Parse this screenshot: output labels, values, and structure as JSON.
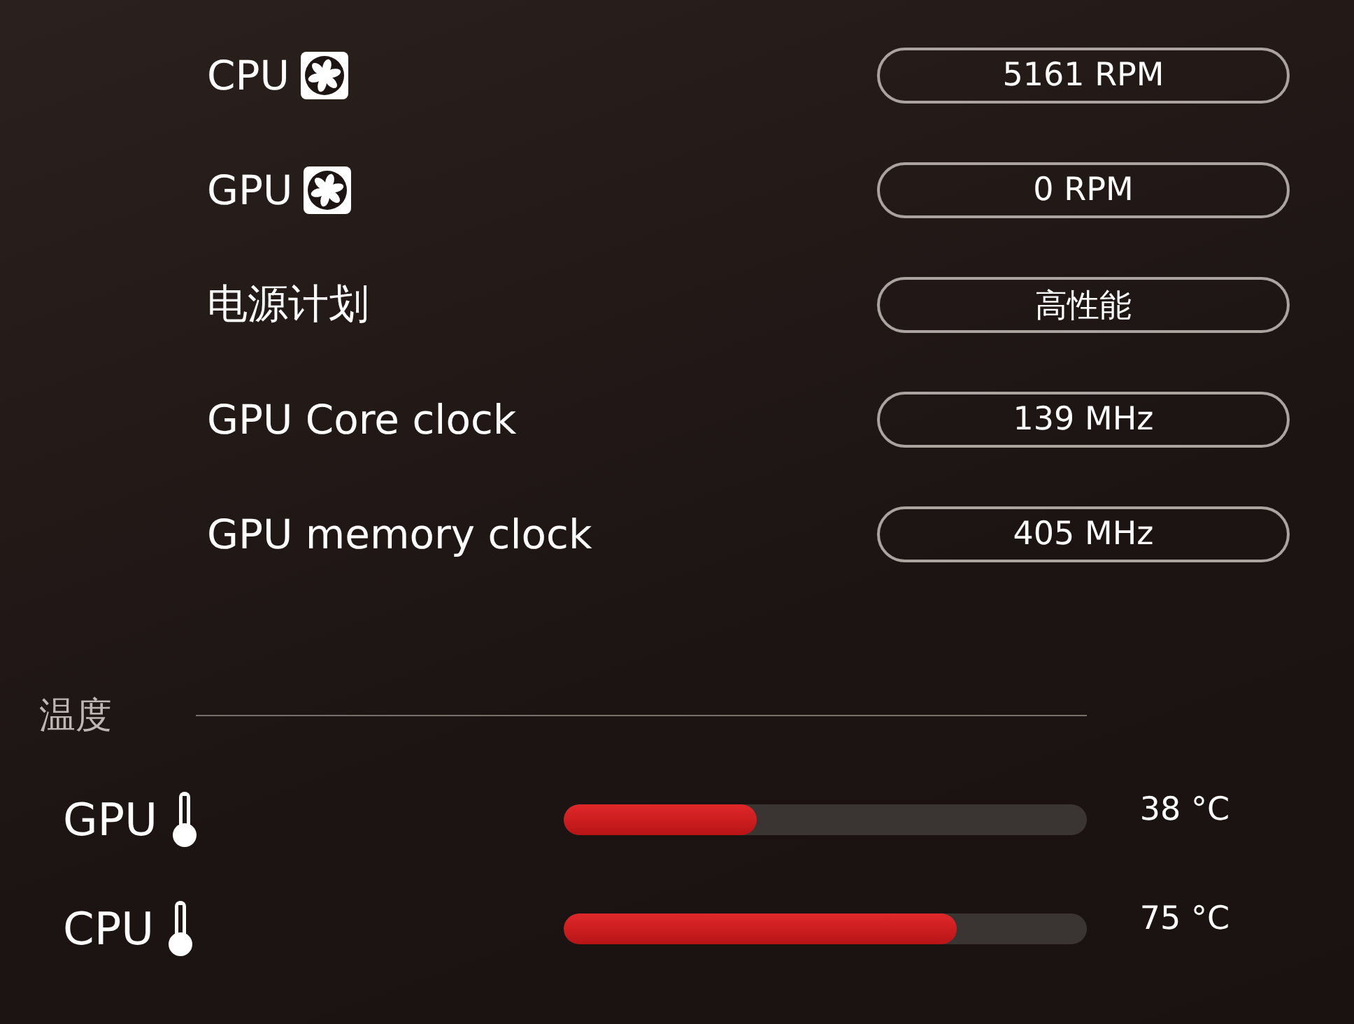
{
  "stats": [
    {
      "label": "CPU",
      "kind": "fan",
      "value": "5161 RPM"
    },
    {
      "label": "GPU",
      "kind": "fan",
      "value": "0 RPM"
    },
    {
      "label": "电源计划",
      "kind": "text",
      "value": "高性能"
    },
    {
      "label": "GPU Core clock",
      "kind": "text",
      "value": "139 MHz"
    },
    {
      "label": "GPU memory clock",
      "kind": "text",
      "value": "405 MHz"
    }
  ],
  "temperature": {
    "title": "温度",
    "sensors": [
      {
        "label": "GPU",
        "level": 0.37,
        "reading": "38 °C"
      },
      {
        "label": "CPU",
        "level": 0.75,
        "reading": "75 °C"
      }
    ]
  }
}
